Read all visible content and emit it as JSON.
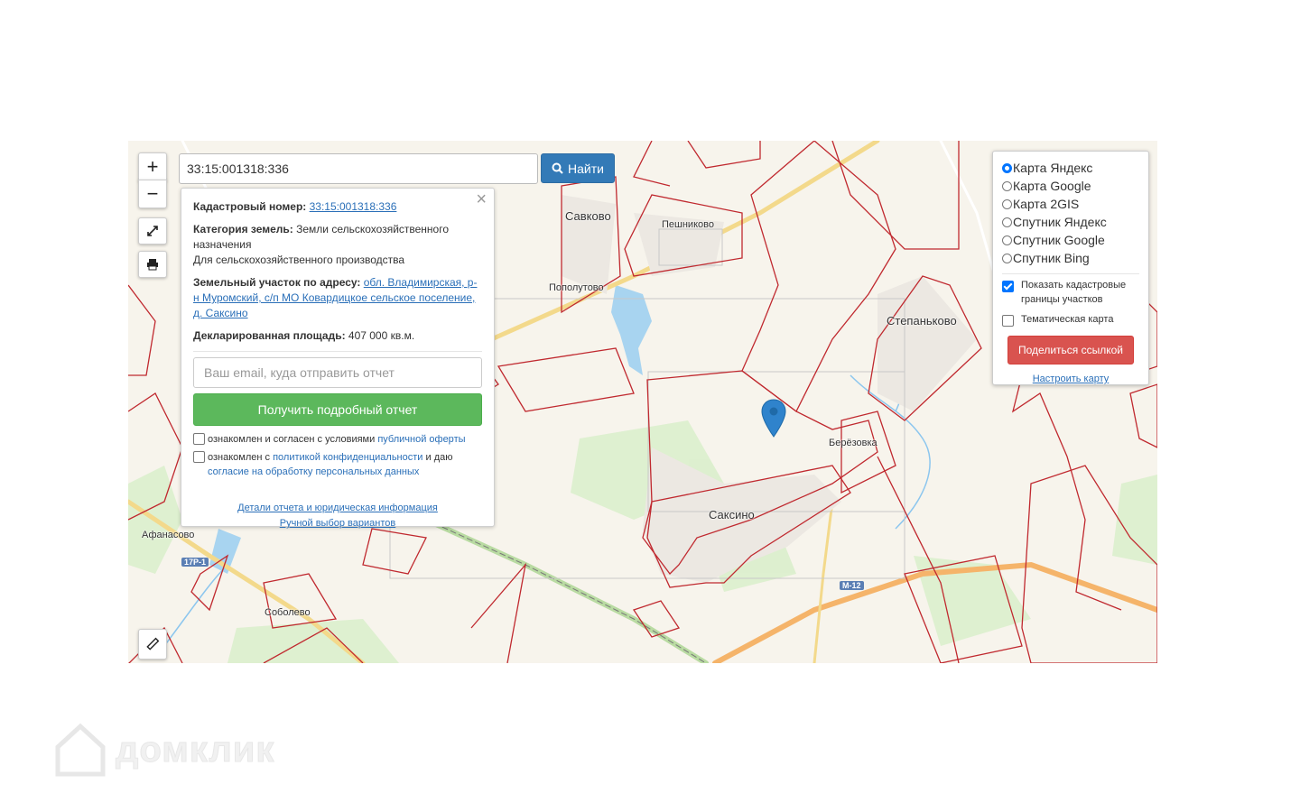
{
  "search": {
    "value": "33:15:001318:336",
    "button_label": "Найти"
  },
  "zoom": {
    "in": "+",
    "out": "−"
  },
  "info_panel": {
    "cadastral_label": "Кадастровый номер:",
    "cadastral_value": "33:15:001318:336",
    "category_label": "Категория земель:",
    "category_value": "Земли сельскохозяйственного назначения",
    "category_use": "Для сельскохозяйственного производства",
    "address_label": "Земельный участок по адресу:",
    "address_value": "обл. Владимирская, р-н Муромский, с/п МО Ковардицкое сельское поселение, д. Саксино",
    "area_label": "Декларированная площадь:",
    "area_value": "407 000 кв.м.",
    "email_placeholder": "Ваш email, куда отправить отчет",
    "report_button": "Получить подробный отчет",
    "consent1_prefix": "ознакомлен и согласен с условиями",
    "consent1_link": "публичной оферты",
    "consent2_prefix": "ознакомлен с",
    "consent2_link": "политикой конфиденциальности",
    "consent2_mid": "и даю",
    "consent2_link2": "согласие на обработку персональных данных",
    "details_link": "Детали отчета и юридическая информация",
    "manual_link": "Ручной выбор вариантов"
  },
  "layers": {
    "options": [
      "Карта Яндекс",
      "Карта Google",
      "Карта 2GIS",
      "Спутник Яндекс",
      "Спутник Google",
      "Спутник Bing"
    ],
    "selected": "Карта Яндекс",
    "show_cadastral": "Показать кадастровые границы участков",
    "thematic": "Тематическая карта",
    "share_button": "Поделиться ссылкой",
    "setup_link": "Настроить карту"
  },
  "places": {
    "savkovo": "Савково",
    "peshnikovo": "Пешниково",
    "popolutovo": "Пополутово",
    "stepankovo": "Степаньково",
    "berezovka": "Берёзовка",
    "saksino": "Саксино",
    "afanasovo": "Афанасово",
    "sobolevo": "Соболево",
    "road_17r1": "17Р-1",
    "road_m12": "М-12"
  },
  "watermark": "домклик",
  "colors": {
    "parcel_border": "#c0292f",
    "primary": "#337ab7",
    "success": "#5cb85c",
    "danger": "#d9534f",
    "road": "#f5b46a",
    "water": "#a8d4f0"
  }
}
